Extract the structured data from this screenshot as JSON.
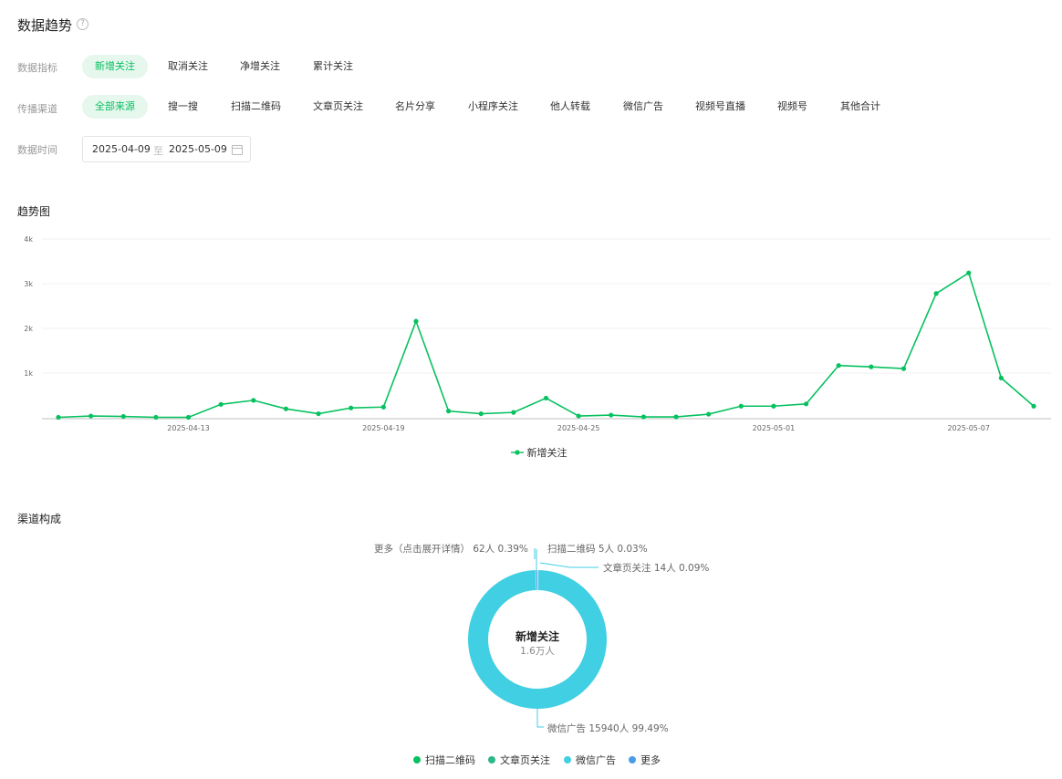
{
  "header": {
    "title": "数据趋势",
    "help_icon": "?"
  },
  "filters": {
    "metric_label": "数据指标",
    "metrics": [
      "新增关注",
      "取消关注",
      "净增关注",
      "累计关注"
    ],
    "metric_selected": 0,
    "channel_label": "传播渠道",
    "channels": [
      "全部来源",
      "搜一搜",
      "扫描二维码",
      "文章页关注",
      "名片分享",
      "小程序关注",
      "他人转载",
      "微信广告",
      "视频号直播",
      "视频号",
      "其他合计"
    ],
    "channel_selected": 0,
    "time_label": "数据时间",
    "date_start": "2025-04-09",
    "date_sep": "至",
    "date_end": "2025-05-09"
  },
  "trend": {
    "title": "趋势图",
    "y_ticks": [
      "4k",
      "3k",
      "2k",
      "1k"
    ],
    "x_tick_labels": [
      "2025-04-13",
      "2025-04-19",
      "2025-04-25",
      "2025-05-01",
      "2025-05-07"
    ],
    "legend_label": "新增关注",
    "color": "#07c160"
  },
  "chart_data": [
    {
      "type": "line",
      "x": [
        "2025-04-09",
        "2025-04-10",
        "2025-04-11",
        "2025-04-12",
        "2025-04-13",
        "2025-04-14",
        "2025-04-15",
        "2025-04-16",
        "2025-04-17",
        "2025-04-18",
        "2025-04-19",
        "2025-04-20",
        "2025-04-21",
        "2025-04-22",
        "2025-04-23",
        "2025-04-24",
        "2025-04-25",
        "2025-04-26",
        "2025-04-27",
        "2025-04-28",
        "2025-04-29",
        "2025-04-30",
        "2025-05-01",
        "2025-05-02",
        "2025-05-03",
        "2025-05-04",
        "2025-05-05",
        "2025-05-06",
        "2025-05-07",
        "2025-05-08",
        "2025-05-09"
      ],
      "series": [
        {
          "name": "新增关注",
          "values": [
            10,
            40,
            30,
            10,
            10,
            300,
            390,
            200,
            90,
            220,
            240,
            2160,
            150,
            90,
            120,
            440,
            40,
            60,
            20,
            20,
            80,
            260,
            260,
            310,
            1170,
            1140,
            1100,
            2780,
            3240,
            890,
            260
          ]
        }
      ],
      "ylim": [
        0,
        4000
      ],
      "y_ticks": [
        1000,
        2000,
        3000,
        4000
      ],
      "grid": true,
      "legend": "bottom-center"
    },
    {
      "type": "pie",
      "title": "新增关注",
      "subtitle": "1.6万人",
      "labels": [
        "扫描二维码",
        "文章页关注",
        "微信广告",
        "更多"
      ],
      "values": [
        5,
        14,
        15940,
        62
      ],
      "percents": [
        0.03,
        0.09,
        99.49,
        0.39
      ],
      "colors": [
        "#07c160",
        "#2cb88a",
        "#40cfe3",
        "#4a9be8"
      ],
      "legend": "bottom-center"
    }
  ],
  "channel_mix": {
    "title": "渠道构成",
    "center_title": "新增关注",
    "center_value": "1.6万人",
    "callouts": {
      "more": "更多（点击展开详情） 62人 0.39%",
      "qr": "扫描二维码 5人 0.03%",
      "article": "文章页关注 14人 0.09%",
      "ads": "微信广告 15940人 99.49%"
    },
    "legend": [
      "扫描二维码",
      "文章页关注",
      "微信广告",
      "更多"
    ]
  }
}
